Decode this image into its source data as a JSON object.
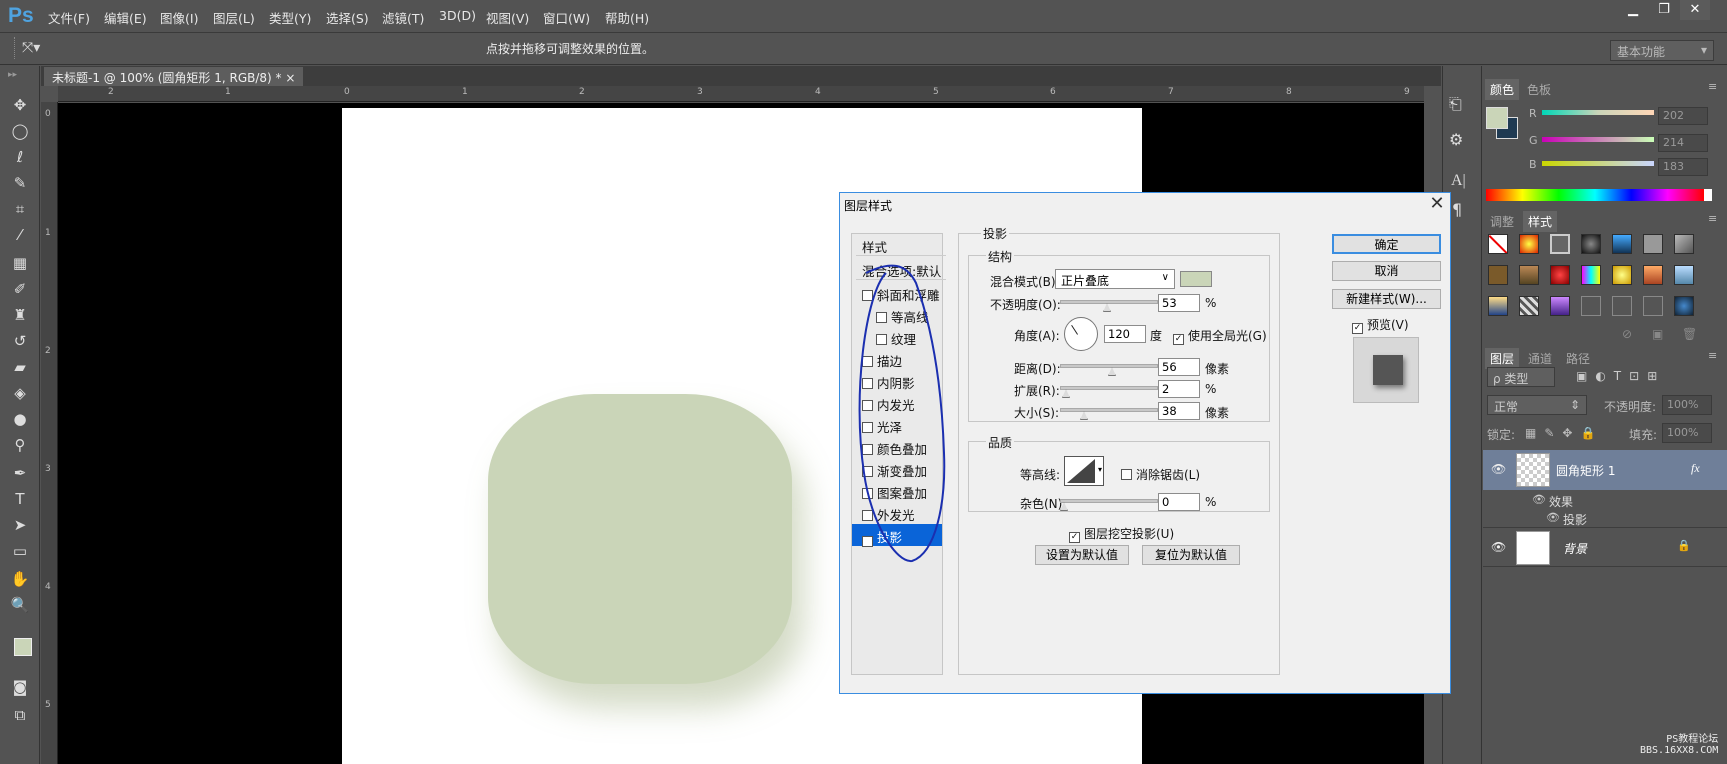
{
  "app": {
    "logo": "Ps"
  },
  "menu": [
    "文件(F)",
    "编辑(E)",
    "图像(I)",
    "图层(L)",
    "类型(Y)",
    "选择(S)",
    "滤镜(T)",
    "3D(D)",
    "视图(V)",
    "窗口(W)",
    "帮助(H)"
  ],
  "window_controls": {
    "minimize": "▁",
    "restore": "❐",
    "close": "✕"
  },
  "options_bar": {
    "tool_icon": "move-icon",
    "hint": "点按并拖移可调整效果的位置。",
    "workspace": "基本功能"
  },
  "document": {
    "tab_title": "未标题-1 @ 100% (圆角矩形 1, RGB/8) *",
    "tab_close": "×",
    "hruler_labels": [
      "2",
      "1",
      "0",
      "1",
      "2",
      "3",
      "4",
      "5",
      "6",
      "7",
      "8",
      "9"
    ],
    "vruler_labels": [
      "0",
      "1",
      "2",
      "3",
      "4",
      "5"
    ],
    "shape_color": "#cad5b8"
  },
  "color_panel": {
    "tabs": [
      "颜色",
      "色板"
    ],
    "channels": [
      {
        "label": "R",
        "value": "202"
      },
      {
        "label": "G",
        "value": "214"
      },
      {
        "label": "B",
        "value": "183"
      }
    ],
    "fg_color": "#cad5b8",
    "bg_color": "#1f3a52"
  },
  "styles_panel": {
    "tabs": [
      "调整",
      "样式"
    ]
  },
  "layers_panel": {
    "tabs": [
      "图层",
      "通道",
      "路径"
    ],
    "filter": "ρ 类型",
    "blend_mode": "正常",
    "opacity_label": "不透明度:",
    "opacity_value": "100%",
    "lock_label": "锁定:",
    "fill_label": "填充:",
    "fill_value": "100%",
    "layers": [
      {
        "name": "圆角矩形 1",
        "fx": "fx",
        "effects_label": "效果",
        "effect": "投影"
      },
      {
        "name": "背景"
      }
    ]
  },
  "dialog": {
    "title": "图层样式",
    "close": "✕",
    "styles_header": "样式",
    "blend_options": "混合选项:默认",
    "style_items": [
      {
        "label": "斜面和浮雕",
        "checked": false,
        "indent": false
      },
      {
        "label": "等高线",
        "checked": false,
        "indent": true
      },
      {
        "label": "纹理",
        "checked": false,
        "indent": true
      },
      {
        "label": "描边",
        "checked": false,
        "indent": false
      },
      {
        "label": "内阴影",
        "checked": false,
        "indent": false
      },
      {
        "label": "内发光",
        "checked": false,
        "indent": false
      },
      {
        "label": "光泽",
        "checked": false,
        "indent": false
      },
      {
        "label": "颜色叠加",
        "checked": false,
        "indent": false
      },
      {
        "label": "渐变叠加",
        "checked": false,
        "indent": false
      },
      {
        "label": "图案叠加",
        "checked": false,
        "indent": false
      },
      {
        "label": "外发光",
        "checked": false,
        "indent": false
      },
      {
        "label": "投影",
        "checked": true,
        "indent": false
      }
    ],
    "section_title": "投影",
    "structure_title": "结构",
    "blend_mode_label": "混合模式(B):",
    "blend_mode_value": "正片叠底",
    "shadow_color": "#cad5b8",
    "opacity_label": "不透明度(O):",
    "opacity_value": "53",
    "opacity_unit": "%",
    "opacity_level": 53,
    "angle_label": "角度(A):",
    "angle_value": "120",
    "angle_unit": "度",
    "global_light_label": "使用全局光(G)",
    "distance_label": "距离(D):",
    "distance_value": "56",
    "distance_unit": "像素",
    "distance_level": 56,
    "spread_label": "扩展(R):",
    "spread_value": "2",
    "spread_unit": "%",
    "spread_level": 2,
    "size_label": "大小(S):",
    "size_value": "38",
    "size_unit": "像素",
    "size_level": 19,
    "quality_title": "品质",
    "contour_label": "等高线:",
    "antialias_label": "消除锯齿(L)",
    "noise_label": "杂色(N):",
    "noise_value": "0",
    "noise_unit": "%",
    "noise_level": 0,
    "knockout_label": "图层挖空投影(U)",
    "set_default": "设置为默认值",
    "reset_default": "复位为默认值",
    "ok": "确定",
    "cancel": "取消",
    "new_style": "新建样式(W)...",
    "preview_label": "预览(V)"
  },
  "watermark": {
    "line1": "PS教程论坛",
    "line2": "BBS.16XX8.COM"
  }
}
